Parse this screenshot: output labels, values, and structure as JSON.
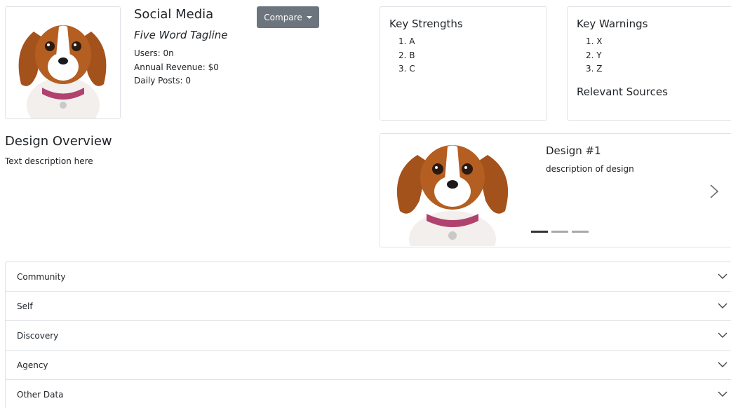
{
  "profile": {
    "title": "Social Media",
    "tagline": "Five Word Tagline",
    "stats": {
      "users": "Users: 0n",
      "revenue": "Annual Revenue: $0",
      "posts": "Daily Posts: 0"
    },
    "image_alt": "dog-photo"
  },
  "compare": {
    "label": "Compare"
  },
  "strengths": {
    "title": "Key Strengths",
    "items": [
      "1. A",
      "2. B",
      "3. C"
    ]
  },
  "warnings": {
    "title": "Key Warnings",
    "items": [
      "1. X",
      "2. Y",
      "3. Z"
    ],
    "sources_title": "Relevant Sources"
  },
  "overview": {
    "title": "Design Overview",
    "text": "Text description here"
  },
  "carousel": {
    "slide_title": "Design #1",
    "slide_description": "description of design",
    "active_index": 0,
    "slide_count": 3
  },
  "accordion": {
    "items": [
      "Community",
      "Self",
      "Discovery",
      "Agency",
      "Other Data"
    ]
  },
  "colors": {
    "button_bg": "#6c757d",
    "border": "#dee2e6",
    "text": "#212529"
  }
}
